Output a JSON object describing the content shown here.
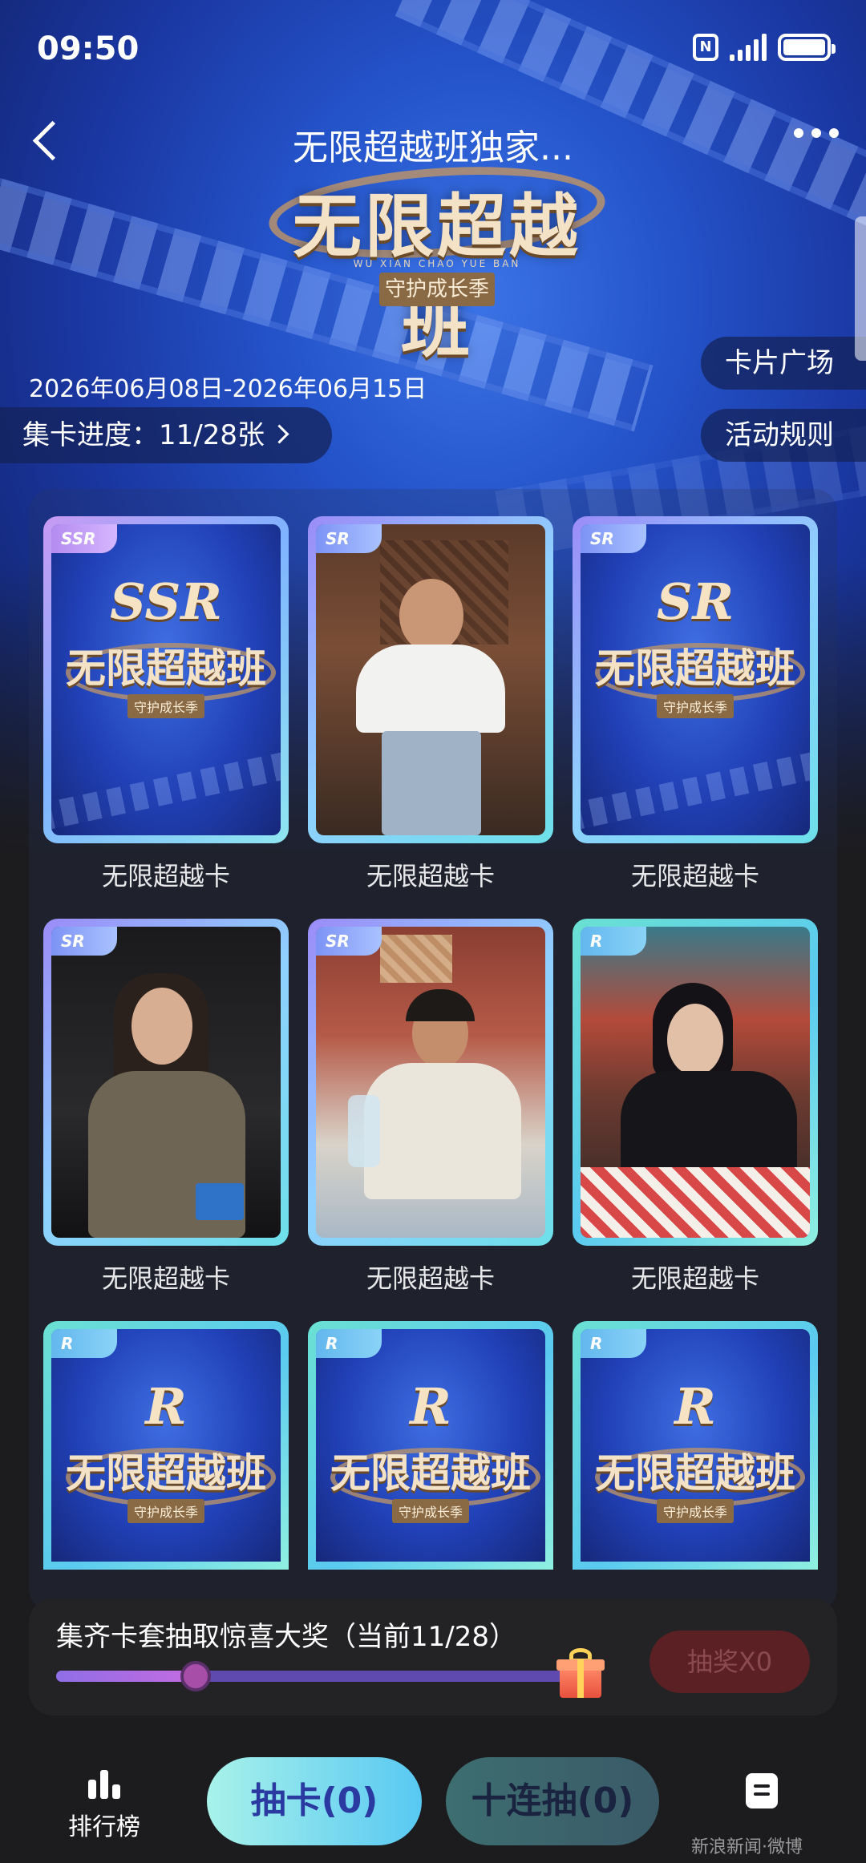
{
  "status_bar": {
    "time": "09:50",
    "nfc": "N"
  },
  "nav": {
    "title": "无限超越班独家..."
  },
  "logo": {
    "main": "无限超越班",
    "pinyin": "WU XIAN CHAO YUE BAN",
    "subtitle": "守护成长季"
  },
  "event": {
    "date_range": "2026年06月08日-2026年06月15日"
  },
  "actions": {
    "card_plaza": "卡片广场",
    "rules": "活动规则"
  },
  "progress": {
    "label": "集卡进度：11/28张"
  },
  "cards": [
    {
      "rarity": "SSR",
      "name": "无限超越卡",
      "face": "logo",
      "mark": "SSR"
    },
    {
      "rarity": "SR",
      "name": "无限超越卡",
      "face": "photo"
    },
    {
      "rarity": "SR",
      "name": "无限超越卡",
      "face": "logo",
      "mark": "SR"
    },
    {
      "rarity": "SR",
      "name": "无限超越卡",
      "face": "photo"
    },
    {
      "rarity": "SR",
      "name": "无限超越卡",
      "face": "photo"
    },
    {
      "rarity": "R",
      "name": "无限超越卡",
      "face": "photo"
    },
    {
      "rarity": "R",
      "name": "",
      "face": "logo",
      "mark": "R"
    },
    {
      "rarity": "R",
      "name": "",
      "face": "logo",
      "mark": "R"
    },
    {
      "rarity": "R",
      "name": "",
      "face": "logo",
      "mark": "R"
    }
  ],
  "card_logo_text": "无限超越班",
  "card_logo_sub": "守护成长季",
  "reward": {
    "title": "集齐卡套抽取惊喜大奖（当前11/28）",
    "progress_fraction": 0.2632,
    "draw_label": "抽奖X0"
  },
  "tabbar": {
    "rank_label": "排行榜",
    "draw_label": "抽卡(0)",
    "ten_draw_label": "十连抽(0)",
    "watermark": "新浪新闻·微博"
  },
  "colors": {
    "accent_purple": "#8f6ee6",
    "draw_btn_bg": "#58c8f2",
    "reward_btn_bg": "#5a2024"
  }
}
